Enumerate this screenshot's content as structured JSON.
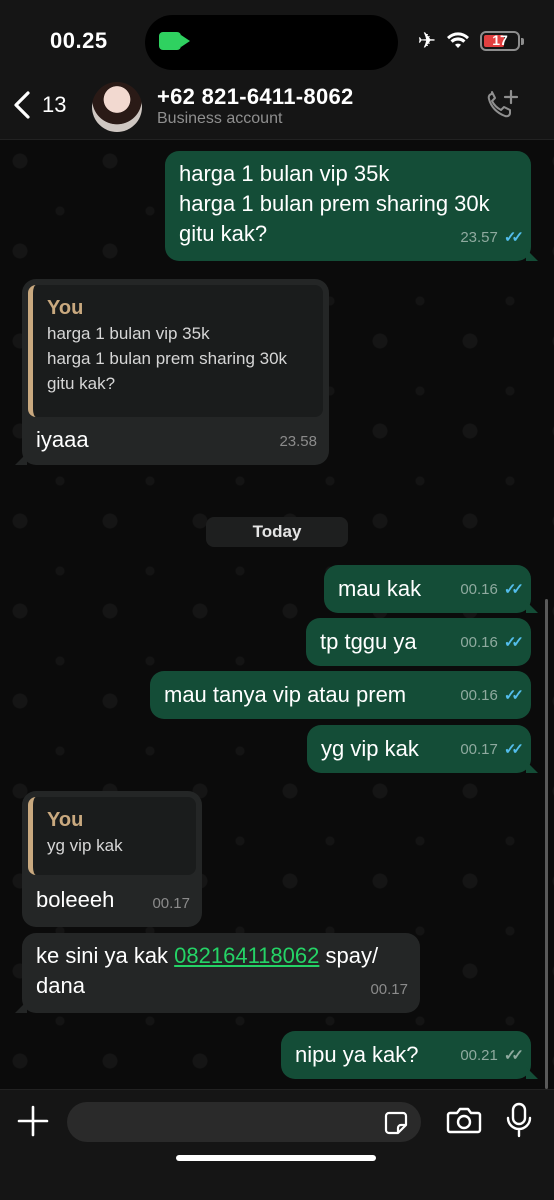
{
  "status_bar": {
    "time": "00.25",
    "battery_level": "17"
  },
  "header": {
    "back_count": "13",
    "contact_name": "+62 821-6411-8062",
    "contact_subtitle": "Business account"
  },
  "messages": [
    {
      "direction": "out",
      "lines": [
        "harga 1 bulan vip 35k",
        "harga 1 bulan prem sharing 30k",
        "gitu kak?"
      ],
      "time": "23.57",
      "status": "read"
    },
    {
      "direction": "in",
      "quote": {
        "author": "You",
        "lines": [
          "harga 1 bulan vip 35k",
          "harga 1 bulan prem sharing 30k",
          "gitu kak?"
        ]
      },
      "text": "iyaaa",
      "time": "23.58"
    },
    {
      "direction": "out",
      "text": "mau kak",
      "time": "00.16",
      "status": "read"
    },
    {
      "direction": "out",
      "text": "tp tggu ya",
      "time": "00.16",
      "status": "read"
    },
    {
      "direction": "out",
      "text": "mau tanya vip atau prem",
      "time": "00.16",
      "status": "read"
    },
    {
      "direction": "out",
      "text": "yg vip kak",
      "time": "00.17",
      "status": "read"
    },
    {
      "direction": "in",
      "quote": {
        "author": "You",
        "lines": [
          "yg vip kak"
        ]
      },
      "text": "boleeeh",
      "time": "00.17"
    },
    {
      "direction": "in",
      "text_before": "ke sini ya kak ",
      "link": "082164118062",
      "text_after": " spay/",
      "line2": "dana",
      "time": "00.17"
    },
    {
      "direction": "out",
      "text": "nipu ya kak?",
      "time": "00.21",
      "status": "delivered"
    }
  ],
  "date_divider": "Today",
  "input": {
    "placeholder": ""
  },
  "icons": {
    "back": "chevron-left-icon",
    "call": "add-call-icon",
    "plus": "plus-icon",
    "sticker": "sticker-icon",
    "camera": "camera-icon",
    "mic": "microphone-icon",
    "airplane": "airplane-icon",
    "wifi": "wifi-icon",
    "video": "video-camera-icon"
  },
  "colors": {
    "outgoing_bubble": "#144d37",
    "incoming_bubble": "#242626",
    "read_ticks": "#53bdeb",
    "quote_accent": "#c9a97f",
    "link": "#25d366"
  }
}
